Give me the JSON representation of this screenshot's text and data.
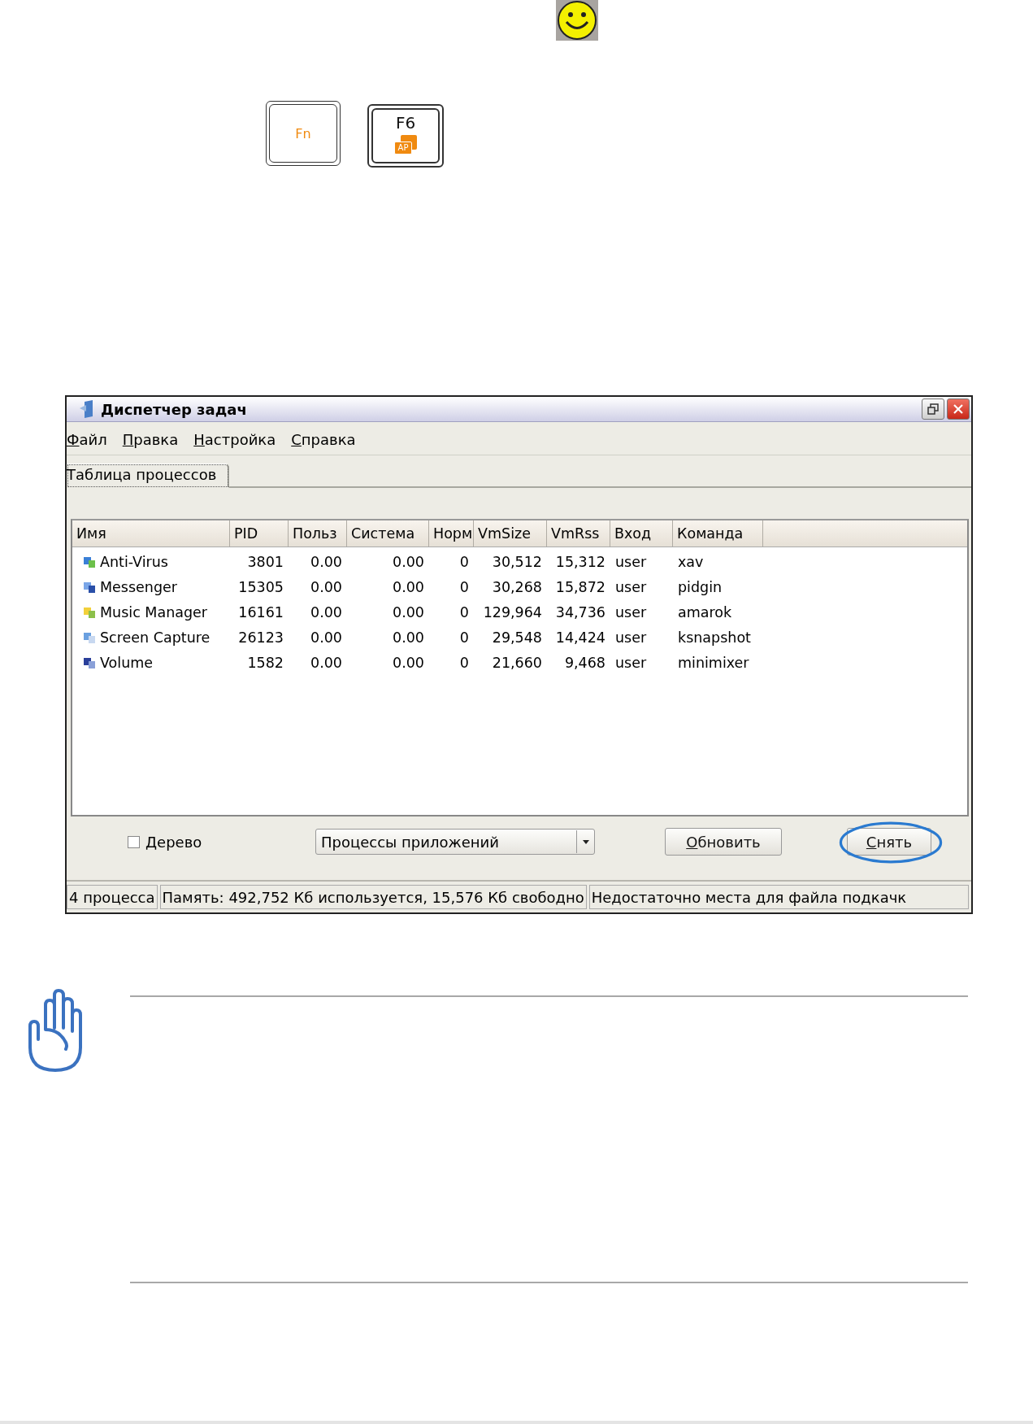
{
  "keys": [
    {
      "label": "Fn",
      "kind": "fn"
    },
    {
      "label": "F6",
      "kind": "function",
      "icon_text": "AP"
    }
  ],
  "window": {
    "title": "Диспетчер задач",
    "menu": [
      "Файл",
      "Правка",
      "Настройка",
      "Справка"
    ],
    "tabs": [
      {
        "label": "Таблица процессов",
        "selected": true
      }
    ],
    "table": {
      "columns": [
        "Имя",
        "PID",
        "Польз",
        "Система",
        "Норм",
        "VmSize",
        "VmRss",
        "Вход",
        "Команда"
      ],
      "rows": [
        {
          "cells": [
            "Anti-Virus",
            "3801",
            "0.00",
            "0.00",
            "0",
            "30,512",
            "15,312",
            "user",
            "xav"
          ]
        },
        {
          "cells": [
            "Messenger",
            "15305",
            "0.00",
            "0.00",
            "0",
            "30,268",
            "15,872",
            "user",
            "pidgin"
          ]
        },
        {
          "cells": [
            "Music Manager",
            "16161",
            "0.00",
            "0.00",
            "0",
            "129,964",
            "34,736",
            "user",
            "amarok"
          ]
        },
        {
          "cells": [
            "Screen Capture",
            "26123",
            "0.00",
            "0.00",
            "0",
            "29,548",
            "14,424",
            "user",
            "ksnapshot"
          ]
        },
        {
          "cells": [
            "Volume",
            "1582",
            "0.00",
            "0.00",
            "0",
            "21,660",
            "9,468",
            "user",
            "minimixer"
          ]
        }
      ]
    },
    "tree_checkbox": {
      "label": "Дерево",
      "checked": false
    },
    "filter_dropdown": {
      "value": "Процессы приложений"
    },
    "buttons": [
      {
        "label": "Обновить",
        "highlighted": false
      },
      {
        "label": "Снять",
        "highlighted": true
      }
    ],
    "status_bar": [
      "4 процесса",
      "Память: 492,752 Кб используется, 15,576 Кб свободно",
      "Недостаточно места для файла подкачк"
    ]
  }
}
